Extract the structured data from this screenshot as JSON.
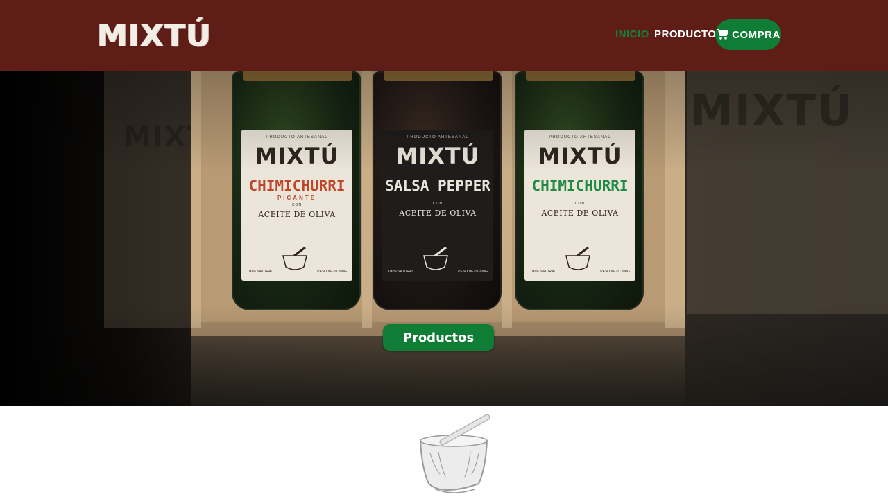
{
  "header": {
    "logo": "MIXTÚ",
    "nav": {
      "inicio": "INICIO",
      "productos": "PRODUCTOS",
      "cart_label": "COMPRA",
      "cart_icon": "cart-icon"
    }
  },
  "hero": {
    "cta_label": "Productos",
    "background_boxes": {
      "left_text": "MIXTÚ",
      "right_text": "MIXTÚ"
    },
    "jars": [
      {
        "top_text": "PRODUCTO ARTESANAL",
        "brand": "MIXTÚ",
        "name": "CHIMICHURRI",
        "sub": "PICANTE",
        "con": "CON",
        "oil": "ACEITE DE OLIVA",
        "natural": "100% NATURAL",
        "weight": "PESO NETO 200g",
        "name_color": "#c0452a"
      },
      {
        "top_text": "PRODUCTO ARTESANAL",
        "brand": "MIXTÚ",
        "name": "SALSA PEPPER",
        "sub": "",
        "con": "CON",
        "oil": "ACEITE DE OLIVA",
        "natural": "100% NATURAL",
        "weight": "PESO NETO 200g",
        "name_color": "#e9e4da"
      },
      {
        "top_text": "PRODUCTO ARTESANAL",
        "brand": "MIXTÚ",
        "name": "CHIMICHURRI",
        "sub": "",
        "con": "CON",
        "oil": "ACEITE DE OLIVA",
        "natural": "100% NATURAL",
        "weight": "PESO NETO 200g",
        "name_color": "#1e8a43"
      }
    ]
  },
  "colors": {
    "header_bg": "#5e1d16",
    "accent_green": "#0f7d35",
    "active_nav": "#11823a"
  },
  "below_hero": {
    "illustration_icon": "mortar-pestle-icon"
  }
}
